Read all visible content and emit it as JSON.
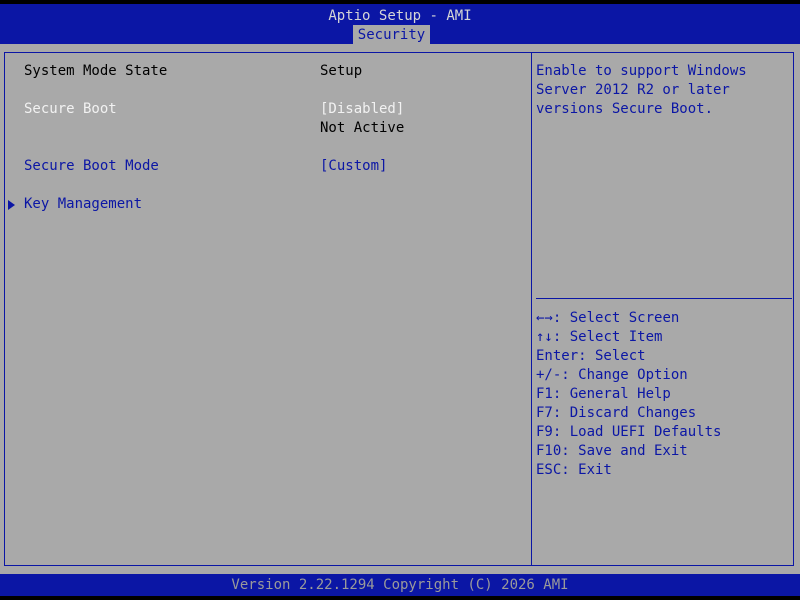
{
  "header": {
    "title": "Aptio Setup - AMI",
    "active_tab": "Security"
  },
  "settings": {
    "system_mode_state": {
      "label": "System Mode State",
      "value": "Setup"
    },
    "secure_boot": {
      "label": "Secure Boot",
      "value": "[Disabled]",
      "status": "Not Active"
    },
    "secure_boot_mode": {
      "label": "Secure Boot Mode",
      "value": "[Custom]"
    },
    "key_management": {
      "label": "Key Management"
    }
  },
  "help": {
    "lines": [
      "Enable to support Windows",
      "Server 2012 R2 or later",
      "versions Secure Boot."
    ]
  },
  "keys": {
    "select_screen": {
      "key": "←→:",
      "text": " Select Screen"
    },
    "select_item": {
      "key": "↑↓:",
      "text": " Select Item"
    },
    "lines": [
      "Enter: Select",
      "+/-: Change Option",
      "F1: General Help",
      "F7: Discard Changes",
      "F9: Load UEFI Defaults",
      "F10: Save and Exit",
      "ESC: Exit"
    ]
  },
  "footer": {
    "text": "Version 2.22.1294 Copyright (C) 2026 AMI"
  },
  "colors": {
    "bios_blue": "#0b16a5",
    "panel_gray": "#a9a9a9",
    "highlight_white": "#f2f2f2"
  }
}
